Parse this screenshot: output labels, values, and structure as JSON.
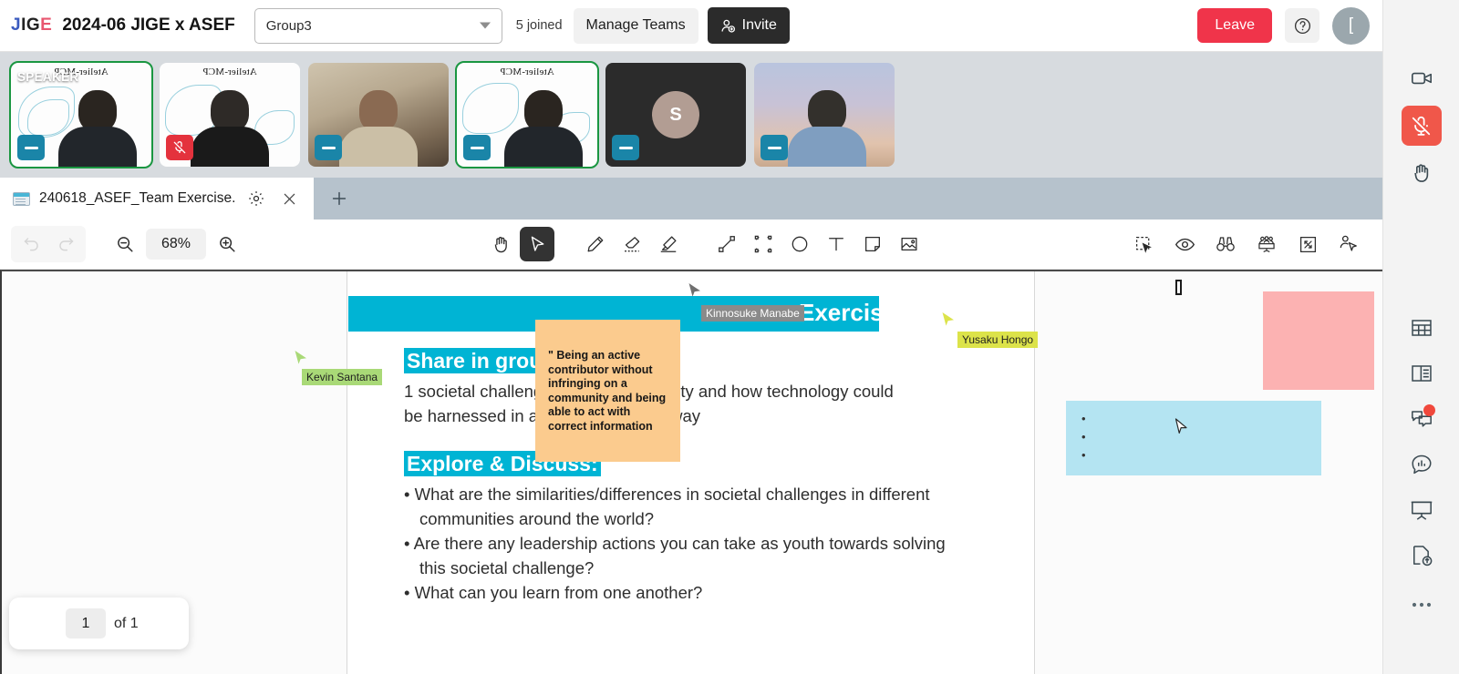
{
  "header": {
    "logo_text": "JIGE",
    "logo_letters": [
      "J",
      "I",
      "G",
      "E"
    ],
    "meeting_title": "2024-06 JIGE x ASEF",
    "group_select_value": "Group3",
    "joined_count_label": "5 joined",
    "manage_teams_label": "Manage Teams",
    "invite_label": "Invite",
    "leave_label": "Leave",
    "help_label": "?",
    "avatar_initial": "["
  },
  "video_strip": {
    "tiles": [
      {
        "name_overlay": "SPEAKER",
        "background_label": "Atelier-MCP",
        "mic_state": "on",
        "is_active_speaker": true,
        "style": "white-bg"
      },
      {
        "name_overlay": "",
        "background_label": "Atelier-MCP",
        "mic_state": "muted",
        "is_active_speaker": false,
        "style": "white-bg"
      },
      {
        "name_overlay": "",
        "background_label": "",
        "mic_state": "on",
        "is_active_speaker": false,
        "style": "room"
      },
      {
        "name_overlay": "",
        "background_label": "Atelier-MCP",
        "mic_state": "on",
        "is_active_speaker": true,
        "style": "white-bg"
      },
      {
        "name_overlay": "",
        "background_label": "",
        "mic_state": "on",
        "is_active_speaker": false,
        "style": "dark",
        "initial": "S"
      },
      {
        "name_overlay": "",
        "background_label": "",
        "mic_state": "on",
        "is_active_speaker": false,
        "style": "sky"
      }
    ]
  },
  "tabbar": {
    "document_name": "240618_ASEF_Team Exercise....",
    "settings_icon": "gear-icon",
    "close_icon": "close-icon",
    "add_tab_icon": "plus-icon"
  },
  "toolbar": {
    "undo_label": "undo-icon",
    "redo_label": "redo-icon",
    "zoom_out_label": "zoom-out-icon",
    "zoom_level": "68%",
    "zoom_in_label": "zoom-in-icon",
    "tools": [
      {
        "name": "hand-icon",
        "selected": false
      },
      {
        "name": "cursor-icon",
        "selected": true
      },
      {
        "name": "pencil-icon",
        "selected": false
      },
      {
        "name": "eraser-icon",
        "selected": false
      },
      {
        "name": "highlighter-icon",
        "selected": false
      },
      {
        "name": "connector-icon",
        "selected": false
      },
      {
        "name": "rectangle-icon",
        "selected": false
      },
      {
        "name": "circle-icon",
        "selected": false
      },
      {
        "name": "text-icon",
        "selected": false
      },
      {
        "name": "sticky-note-icon",
        "selected": false
      },
      {
        "name": "image-icon",
        "selected": false
      }
    ],
    "right_tools": [
      {
        "name": "select-area-icon"
      },
      {
        "name": "eye-icon"
      },
      {
        "name": "binoculars-icon"
      },
      {
        "name": "audience-view-icon"
      },
      {
        "name": "fullscreen-icon"
      },
      {
        "name": "follow-user-icon"
      }
    ]
  },
  "canvas": {
    "slide_title": "Exercise",
    "share_heading": "Share in groups:",
    "share_line_1": "1 societal challenge in your community and how technology could",
    "share_line_2": "be harnessed in a human-centered way",
    "explore_heading": "Explore & Discuss:",
    "bullets": [
      "What are the similarities/differences in societal challenges in different communities around the world?",
      "Are there any leadership actions you can take as youth towards solving this societal challenge?",
      "What can you learn from one another?"
    ],
    "sticky_orange_text": "\" Being an active contributor without infringing on a community and being able to act with correct information",
    "sticky_pink_text": "",
    "sticky_blue_bullets": [
      "•",
      "•",
      "•"
    ],
    "cursors": [
      {
        "label": "Kinnosuke Manabe",
        "color": "#8a8a8a",
        "text_color": "#ffffff"
      },
      {
        "label": "Kevin Santana",
        "color": "#a9d977",
        "text_color": "#1f1f1f"
      },
      {
        "label": "Yusaku Hongo",
        "color": "#dce34a",
        "text_color": "#1f1f1f"
      }
    ],
    "page_current": "1",
    "page_of_label": "of 1"
  },
  "rail": {
    "items": [
      {
        "name": "camera-icon",
        "active": false
      },
      {
        "name": "mic-muted-icon",
        "active": true
      },
      {
        "name": "raise-hand-icon",
        "active": false
      },
      {
        "name": "grid-table-icon",
        "active": false
      },
      {
        "name": "layout-panel-icon",
        "active": false
      },
      {
        "name": "chat-icon",
        "active": false,
        "badge": true
      },
      {
        "name": "poll-icon",
        "active": false
      },
      {
        "name": "presentation-icon",
        "active": false
      },
      {
        "name": "file-upload-icon",
        "active": false
      },
      {
        "name": "more-options-icon",
        "active": false
      }
    ]
  },
  "colors": {
    "accent_cyan": "#00b4d4",
    "leave_red": "#f0344a",
    "active_speaker_green": "#1a9641",
    "mic_on_blue": "#1a85a8",
    "mic_off_red": "#e4323d"
  }
}
